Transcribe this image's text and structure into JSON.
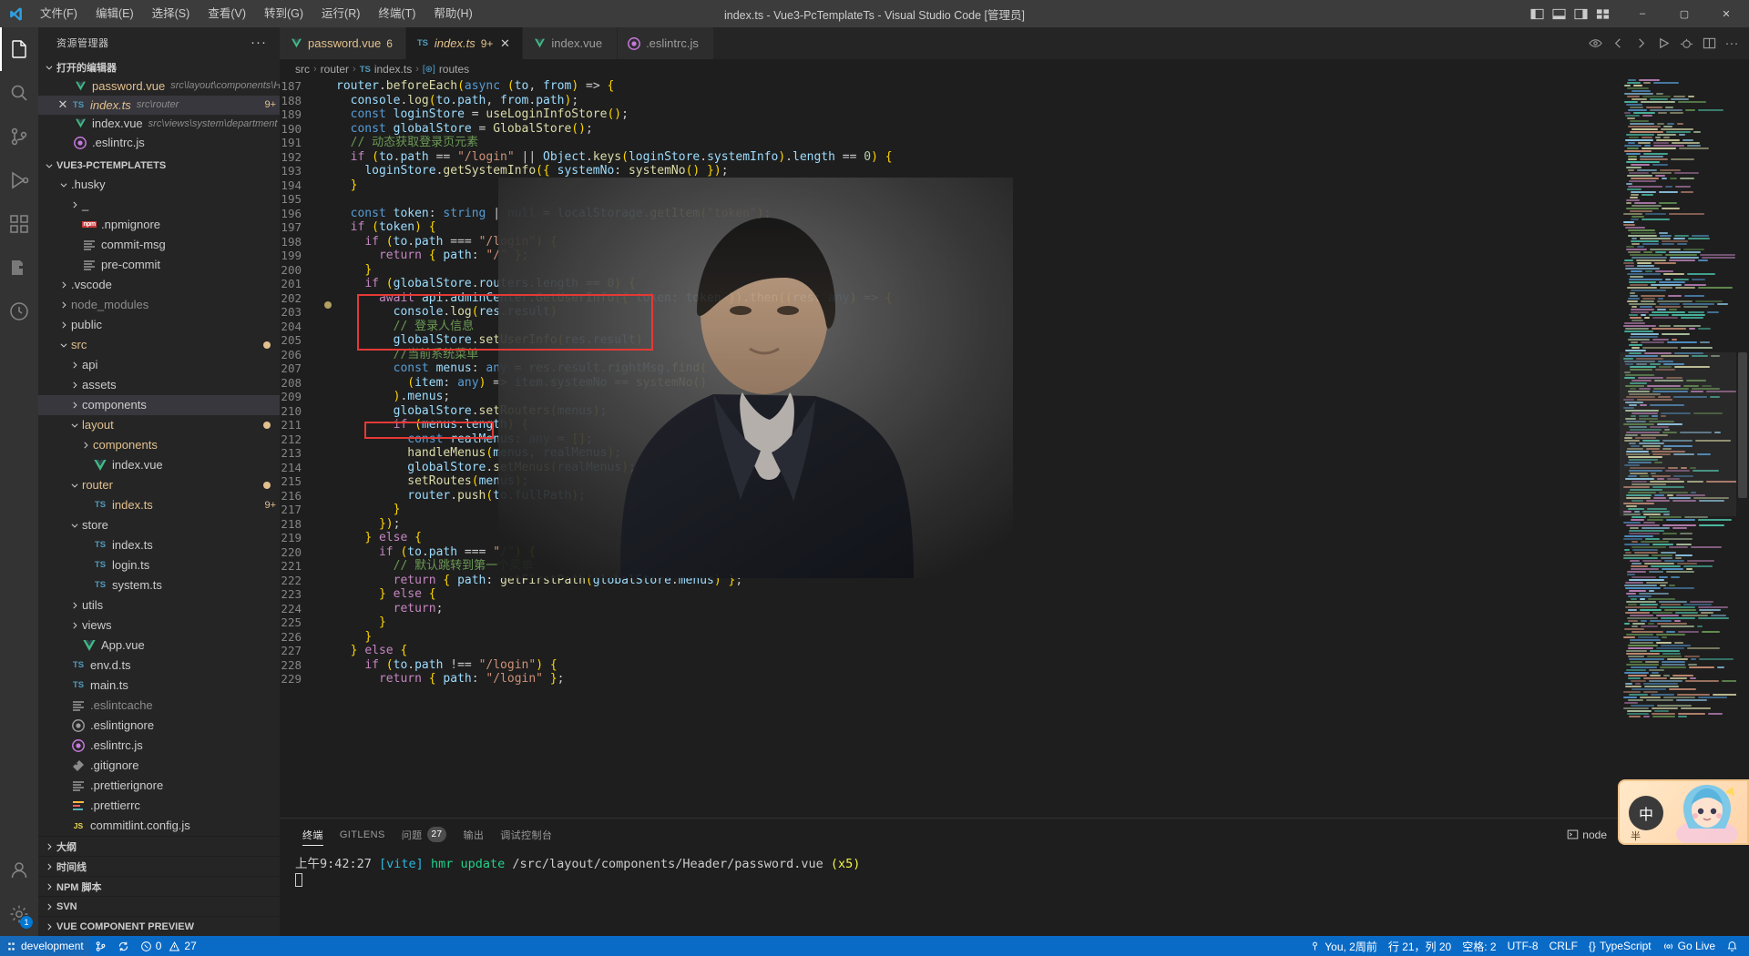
{
  "titlebar": {
    "title": "index.ts - Vue3-PcTemplateTs - Visual Studio Code [管理员]",
    "menu": [
      "文件(F)",
      "编辑(E)",
      "选择(S)",
      "查看(V)",
      "转到(G)",
      "运行(R)",
      "终端(T)",
      "帮助(H)"
    ],
    "window_buttons": {
      "minimize": "–",
      "maximize": "▢",
      "close": "✕"
    },
    "layout_icons": [
      "toggle-primary-sidebar-icon",
      "toggle-panel-icon",
      "toggle-secondary-sidebar-icon",
      "customize-layout-icon"
    ]
  },
  "activitybar": {
    "items": [
      {
        "name": "explorer",
        "icon": "files-icon",
        "active": true
      },
      {
        "name": "search",
        "icon": "search-icon",
        "active": false
      },
      {
        "name": "source-control",
        "icon": "source-control-icon",
        "active": false
      },
      {
        "name": "run-and-debug",
        "icon": "debug-icon",
        "active": false
      },
      {
        "name": "extensions",
        "icon": "extensions-icon",
        "active": false
      },
      {
        "name": "gitlens",
        "icon": "gitlens-icon",
        "active": false
      },
      {
        "name": "todo-tree",
        "icon": "todo-tree-icon",
        "active": false
      }
    ],
    "bottom": [
      {
        "name": "accounts",
        "icon": "account-icon",
        "badge": ""
      },
      {
        "name": "manage",
        "icon": "gear-icon",
        "badge": "1"
      }
    ]
  },
  "sidebar": {
    "header": "资源管理器",
    "more_actions": "···",
    "open_editors": {
      "label": "打开的编辑器",
      "items": [
        {
          "name": "password.vue",
          "path": "src\\layout\\components\\He...",
          "icon": "vue-icon",
          "badge": "6",
          "closable": false,
          "selected": false
        },
        {
          "name": "index.ts",
          "path": "src\\router",
          "icon": "ts-icon",
          "badge": "9+",
          "closable": true,
          "selected": true
        },
        {
          "name": "index.vue",
          "path": "src\\views\\system\\department",
          "icon": "vue-icon",
          "badge": "",
          "closable": false,
          "selected": false
        },
        {
          "name": ".eslintrc.js",
          "path": "",
          "icon": "eslint-icon",
          "badge": "",
          "closable": false,
          "selected": false
        }
      ]
    },
    "project": {
      "label": "VUE3-PCTEMPLATETS",
      "tree": [
        {
          "label": ".husky",
          "depth": 1,
          "kind": "folder",
          "expanded": true
        },
        {
          "label": "_",
          "depth": 2,
          "kind": "folder",
          "expanded": false
        },
        {
          "label": ".npmignore",
          "depth": 2,
          "kind": "npm"
        },
        {
          "label": "commit-msg",
          "depth": 2,
          "kind": "text"
        },
        {
          "label": "pre-commit",
          "depth": 2,
          "kind": "text"
        },
        {
          "label": ".vscode",
          "depth": 1,
          "kind": "folder",
          "expanded": false
        },
        {
          "label": "node_modules",
          "depth": 1,
          "kind": "folder",
          "expanded": false,
          "dim": true
        },
        {
          "label": "public",
          "depth": 1,
          "kind": "folder",
          "expanded": false
        },
        {
          "label": "src",
          "depth": 1,
          "kind": "folder",
          "expanded": true,
          "accent": true,
          "dot": true
        },
        {
          "label": "api",
          "depth": 2,
          "kind": "folder",
          "expanded": false
        },
        {
          "label": "assets",
          "depth": 2,
          "kind": "folder",
          "expanded": false
        },
        {
          "label": "components",
          "depth": 2,
          "kind": "folder",
          "expanded": false,
          "hover": true
        },
        {
          "label": "layout",
          "depth": 2,
          "kind": "folder",
          "expanded": true,
          "accent": true,
          "dot": true
        },
        {
          "label": "components",
          "depth": 3,
          "kind": "folder",
          "expanded": false,
          "accent": true
        },
        {
          "label": "index.vue",
          "depth": 3,
          "kind": "vue"
        },
        {
          "label": "router",
          "depth": 2,
          "kind": "folder",
          "expanded": true,
          "accent": true,
          "dot": true
        },
        {
          "label": "index.ts",
          "depth": 3,
          "kind": "ts",
          "accent": true,
          "badge": "9+"
        },
        {
          "label": "store",
          "depth": 2,
          "kind": "folder",
          "expanded": true
        },
        {
          "label": "index.ts",
          "depth": 3,
          "kind": "ts"
        },
        {
          "label": "login.ts",
          "depth": 3,
          "kind": "ts"
        },
        {
          "label": "system.ts",
          "depth": 3,
          "kind": "ts"
        },
        {
          "label": "utils",
          "depth": 2,
          "kind": "folder",
          "expanded": false
        },
        {
          "label": "views",
          "depth": 2,
          "kind": "folder",
          "expanded": false
        },
        {
          "label": "App.vue",
          "depth": 2,
          "kind": "vue"
        },
        {
          "label": "env.d.ts",
          "depth": 1,
          "kind": "ts"
        },
        {
          "label": "main.ts",
          "depth": 1,
          "kind": "ts"
        },
        {
          "label": ".eslintcache",
          "depth": 1,
          "kind": "text",
          "dim": true
        },
        {
          "label": ".eslintignore",
          "depth": 1,
          "kind": "eslint-gray"
        },
        {
          "label": ".eslintrc.js",
          "depth": 1,
          "kind": "eslint"
        },
        {
          "label": ".gitignore",
          "depth": 1,
          "kind": "git"
        },
        {
          "label": ".prettierignore",
          "depth": 1,
          "kind": "text"
        },
        {
          "label": ".prettierrc",
          "depth": 1,
          "kind": "prettier"
        },
        {
          "label": "commitlint.config.js",
          "depth": 1,
          "kind": "js"
        }
      ]
    },
    "bottom_sections": [
      "大纲",
      "时间线",
      "NPM 脚本",
      "SVN",
      "VUE COMPONENT PREVIEW"
    ]
  },
  "editor": {
    "tabs": [
      {
        "label": "password.vue",
        "icon": "vue-icon",
        "badge": "6",
        "active": false,
        "closable": false
      },
      {
        "label": "index.ts",
        "icon": "ts-icon",
        "badge": "9+",
        "active": true,
        "closable": true
      },
      {
        "label": "index.vue",
        "icon": "vue-icon",
        "badge": "",
        "active": false,
        "closable": false
      },
      {
        "label": ".eslintrc.js",
        "icon": "eslint-icon",
        "badge": "",
        "active": false,
        "closable": false
      }
    ],
    "tab_actions": [
      "split-editor-icon",
      "more-actions-icon"
    ],
    "toolbar_icons": [
      "eye-icon",
      "chevron-left-icon",
      "chevron-right-icon",
      "run-icon",
      "debug-icon",
      "split-icon",
      "ellipsis-icon"
    ],
    "breadcrumb": [
      {
        "text": "src",
        "icon": ""
      },
      {
        "text": "router",
        "icon": ""
      },
      {
        "text": "index.ts",
        "icon": "ts-icon"
      },
      {
        "text": "routes",
        "icon": "symbol-icon"
      }
    ],
    "first_line_number": 187,
    "lines": [
      {
        "n": 187,
        "text": "router.beforeEach(async (to, from) => {"
      },
      {
        "n": 188,
        "text": "  console.log(to.path, from.path);"
      },
      {
        "n": 189,
        "text": "  const loginStore = useLoginInfoStore();"
      },
      {
        "n": 190,
        "text": "  const globalStore = GlobalStore();"
      },
      {
        "n": 191,
        "text": "  // 动态获取登录页元素"
      },
      {
        "n": 192,
        "text": "  if (to.path == \"/login\" || Object.keys(loginStore.systemInfo).length == 0) {"
      },
      {
        "n": 193,
        "text": "    loginStore.getSystemInfo({ systemNo: systemNo() });"
      },
      {
        "n": 194,
        "text": "  }"
      },
      {
        "n": 195,
        "text": ""
      },
      {
        "n": 196,
        "text": "  const token: string | null = localStorage.getItem(\"token\");"
      },
      {
        "n": 197,
        "text": "  if (token) {"
      },
      {
        "n": 198,
        "text": "    if (to.path === \"/login\") {"
      },
      {
        "n": 199,
        "text": "      return { path: \"/\" };"
      },
      {
        "n": 200,
        "text": "    }"
      },
      {
        "n": 201,
        "text": "    if (globalStore.routers.length == 0) {"
      },
      {
        "n": 202,
        "text": "      await api.adminCenter.GetUserInfo({ token: token }).then((res: any) => {"
      },
      {
        "n": 203,
        "text": "        console.log(res.result)"
      },
      {
        "n": 204,
        "text": "        // 登录人信息"
      },
      {
        "n": 205,
        "text": "        globalStore.setUserInfo(res.result)"
      },
      {
        "n": 206,
        "text": "        //当前系统菜单"
      },
      {
        "n": 207,
        "text": "        const menus: any = res.result.rightMsg.find("
      },
      {
        "n": 208,
        "text": "          (item: any) => item.systemNo == systemNo()"
      },
      {
        "n": 209,
        "text": "        ).menus;"
      },
      {
        "n": 210,
        "text": "        globalStore.setRouters(menus);"
      },
      {
        "n": 211,
        "text": "        if (menus.length) {"
      },
      {
        "n": 212,
        "text": "          const realMenus: any = [];"
      },
      {
        "n": 213,
        "text": "          handleMenus(menus, realMenus);"
      },
      {
        "n": 214,
        "text": "          globalStore.setMenus(realMenus);"
      },
      {
        "n": 215,
        "text": "          setRoutes(menus);"
      },
      {
        "n": 216,
        "text": "          router.push(to.fullPath);"
      },
      {
        "n": 217,
        "text": "        }"
      },
      {
        "n": 218,
        "text": "      });"
      },
      {
        "n": 219,
        "text": "    } else {"
      },
      {
        "n": 220,
        "text": "      if (to.path === \"/\") {"
      },
      {
        "n": 221,
        "text": "        // 默认跳转到第一个菜单"
      },
      {
        "n": 222,
        "text": "        return { path: getFirstPath(globalStore.menus) };"
      },
      {
        "n": 223,
        "text": "      } else {"
      },
      {
        "n": 224,
        "text": "        return;"
      },
      {
        "n": 225,
        "text": "      }"
      },
      {
        "n": 226,
        "text": "    }"
      },
      {
        "n": 227,
        "text": "  } else {"
      },
      {
        "n": 228,
        "text": "    if (to.path !== \"/login\") {"
      },
      {
        "n": 229,
        "text": "      return { path: \"/login\" };"
      }
    ],
    "annotations": [
      {
        "name": "menus-find-highlight",
        "from_line": 206,
        "to_line": 209
      },
      {
        "name": "set-routes-highlight",
        "from_line": 215,
        "to_line": 215
      }
    ]
  },
  "panel": {
    "tabs": [
      {
        "label": "终端",
        "active": true,
        "badge": ""
      },
      {
        "label": "GITLENS",
        "active": false,
        "badge": ""
      },
      {
        "label": "问题",
        "active": false,
        "badge": "27"
      },
      {
        "label": "输出",
        "active": false,
        "badge": ""
      },
      {
        "label": "调试控制台",
        "active": false,
        "badge": ""
      }
    ],
    "shell_label": "node",
    "actions": [
      "launch-profile-icon",
      "new-terminal-icon",
      "split-terminal-icon",
      "kill-terminal-icon",
      "maximize-panel-icon",
      "close-panel-icon"
    ],
    "terminal": {
      "time": "上午9:42:27",
      "tag": "[vite]",
      "action": "hmr update",
      "path": "/src/layout/components/Header/password.vue",
      "count": "(x5)"
    }
  },
  "statusbar": {
    "remote_label": "development",
    "left": [
      {
        "name": "remote-indicator",
        "icon": "remote-icon",
        "label": "development"
      },
      {
        "name": "source-control-branch",
        "icon": "branch-icon",
        "label": ""
      },
      {
        "name": "sync-changes",
        "icon": "sync-icon",
        "label": ""
      },
      {
        "name": "problems",
        "icon": "error-icon",
        "label": "0 ⚠ 27"
      }
    ],
    "errors": "0",
    "warnings": "27",
    "right": [
      {
        "name": "gitlens-blame",
        "label": "You, 2周前"
      },
      {
        "name": "editor-position",
        "label": "行 21，列 20"
      },
      {
        "name": "editor-indentation",
        "label": "空格: 2"
      },
      {
        "name": "editor-encoding",
        "label": "UTF-8"
      },
      {
        "name": "editor-eol",
        "label": "CRLF"
      },
      {
        "name": "editor-language",
        "label": "TypeScript"
      },
      {
        "name": "go-live",
        "label": "Go Live"
      },
      {
        "name": "notifications",
        "label": ""
      }
    ]
  },
  "ime_widget": {
    "mode": "中",
    "sub": "半",
    "name": "ime-floating-toolbar"
  }
}
